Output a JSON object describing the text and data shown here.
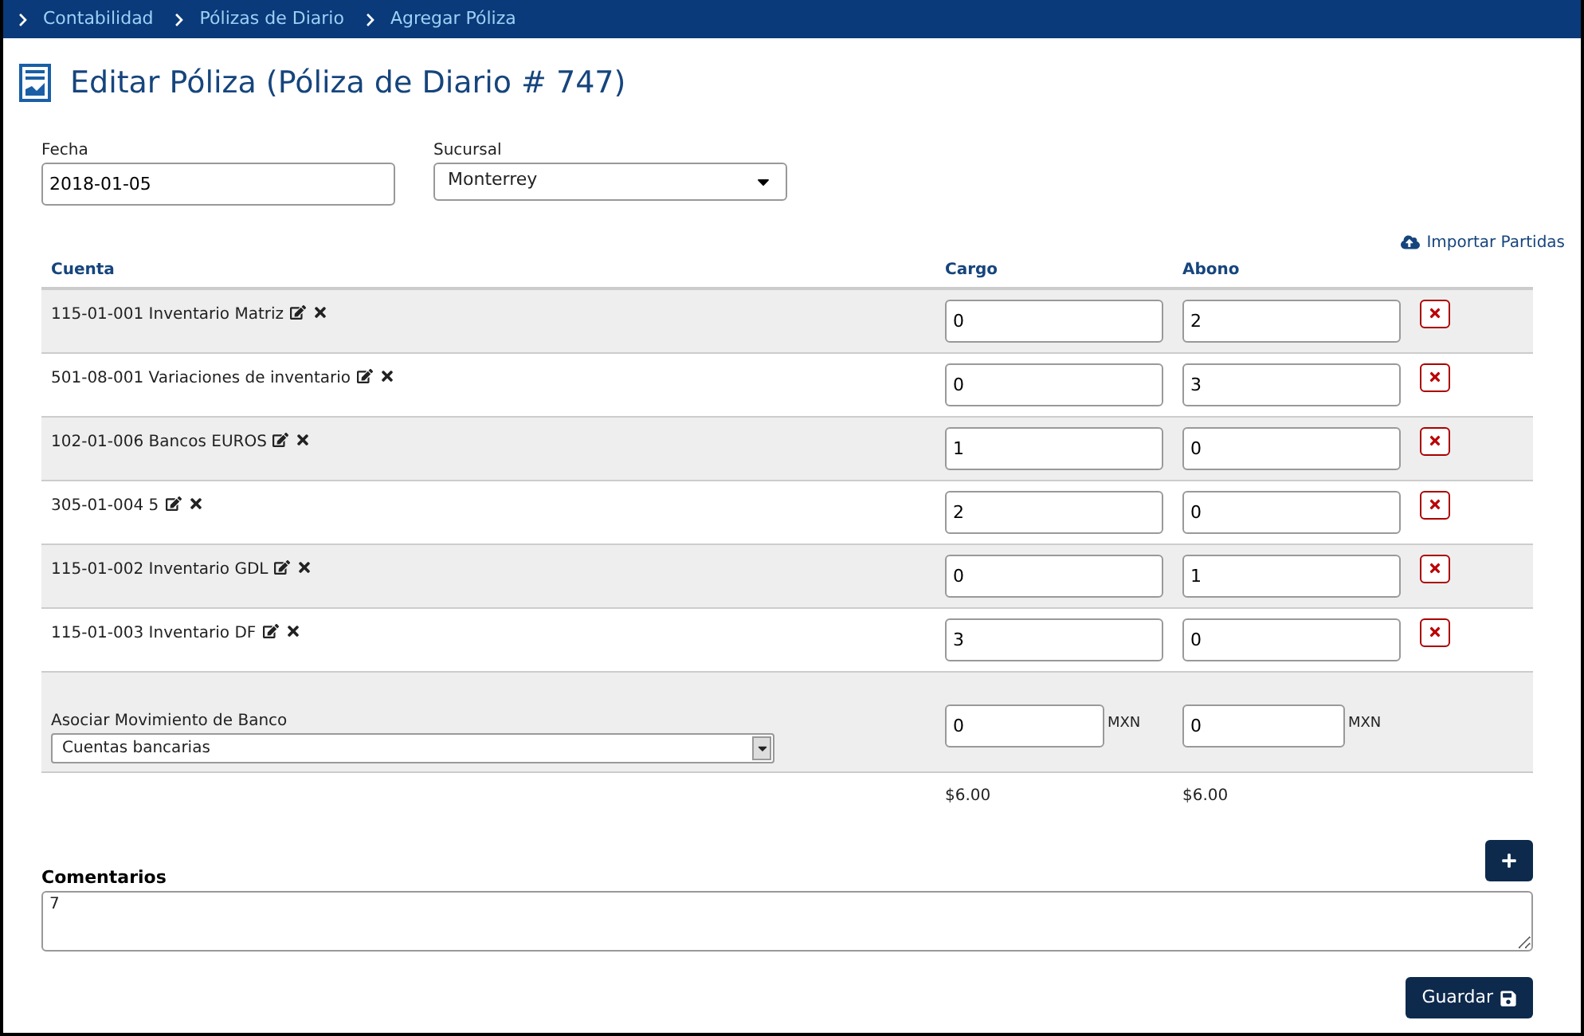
{
  "breadcrumb": [
    "Contabilidad",
    "Pólizas de Diario",
    "Agregar Póliza"
  ],
  "title": "Editar Póliza (Póliza de Diario # 747)",
  "fecha": {
    "label": "Fecha",
    "value": "2018-01-05"
  },
  "sucursal": {
    "label": "Sucursal",
    "value": "Monterrey"
  },
  "import_link": "Importar Partidas",
  "table": {
    "columns": [
      "Cuenta",
      "Cargo",
      "Abono"
    ],
    "rows": [
      {
        "cuenta": "115-01-001 Inventario Matriz",
        "cargo": "0",
        "abono": "2"
      },
      {
        "cuenta": "501-08-001 Variaciones de inventario",
        "cargo": "0",
        "abono": "3"
      },
      {
        "cuenta": "102-01-006 Bancos EUROS",
        "cargo": "1",
        "abono": "0"
      },
      {
        "cuenta": "305-01-004 5",
        "cargo": "2",
        "abono": "0"
      },
      {
        "cuenta": "115-01-002 Inventario GDL",
        "cargo": "0",
        "abono": "1"
      },
      {
        "cuenta": "115-01-003 Inventario DF",
        "cargo": "3",
        "abono": "0"
      }
    ]
  },
  "bank": {
    "label": "Asociar Movimiento de Banco",
    "select": "Cuentas bancarias",
    "cargo": "0",
    "abono": "0",
    "currency_cargo": "MXN",
    "currency_abono": "MXN"
  },
  "totals": {
    "cargo": "$6.00",
    "abono": "$6.00"
  },
  "comments": {
    "label": "Comentarios",
    "value": "7"
  },
  "save_button": "Guardar"
}
